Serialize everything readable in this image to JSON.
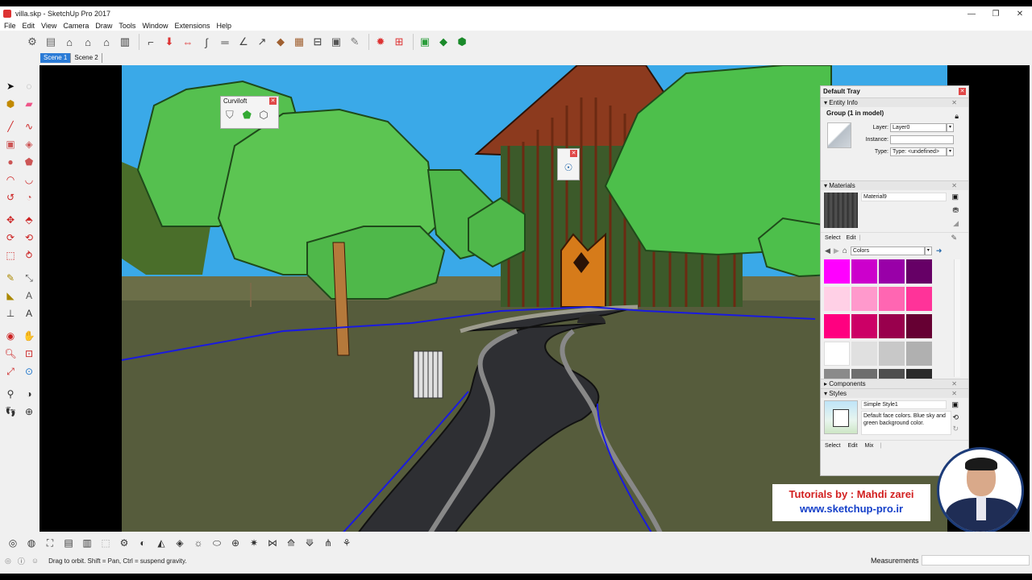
{
  "window": {
    "title": "villa.skp - SketchUp Pro 2017",
    "controls": [
      "—",
      "❐",
      "✕"
    ]
  },
  "menu": [
    "File",
    "Edit",
    "View",
    "Camera",
    "Draw",
    "Tools",
    "Window",
    "Extensions",
    "Help"
  ],
  "scenes": [
    {
      "label": "Scene 1",
      "active": true
    },
    {
      "label": "Scene 2",
      "active": false
    }
  ],
  "curviloft": {
    "title": "Curviloft"
  },
  "tray": {
    "title": "Default Tray",
    "entity_info": {
      "header": "Entity Info",
      "selection": "Group (1 in model)",
      "layer_label": "Layer:",
      "layer_value": "Layer0",
      "instance_label": "Instance:",
      "instance_value": "",
      "type_label": "Type:",
      "type_value": "Type: <undefined>"
    },
    "materials": {
      "header": "Materials",
      "material_name": "Material9",
      "select_tab": "Select",
      "edit_tab": "Edit",
      "library": "Colors",
      "swatches": [
        "#ff00ff",
        "#cc00cc",
        "#9900a8",
        "#660066",
        "#ffd0e6",
        "#ff99cc",
        "#ff66b2",
        "#ff3399",
        "#ff0080",
        "#cc0066",
        "#99004d",
        "#660033",
        "#ffffff",
        "#e0e0e0",
        "#c8c8c8",
        "#b0b0b0",
        "#8a8a8a",
        "#6e6e6e",
        "#4e4e4e",
        "#2a2a2a"
      ]
    },
    "components": {
      "header": "Components"
    },
    "styles": {
      "header": "Styles",
      "style_name": "Simple Style1",
      "style_desc": "Default face colors. Blue sky and green background color.",
      "select_tab": "Select",
      "edit_tab": "Edit",
      "mix_tab": "Mix"
    }
  },
  "status": {
    "hint": "Drag to orbit. Shift = Pan, Ctrl = suspend gravity.",
    "measurements_label": "Measurements",
    "measurements_value": ""
  },
  "branding": {
    "line1": "Tutorials by : Mahdi zarei",
    "line2": "www.sketchup-pro.ir"
  },
  "colors": {
    "sky": "#3aa9e8",
    "ground": "#5a5f3e",
    "tree": "#4db84a",
    "accent": "#2b7bd6"
  }
}
